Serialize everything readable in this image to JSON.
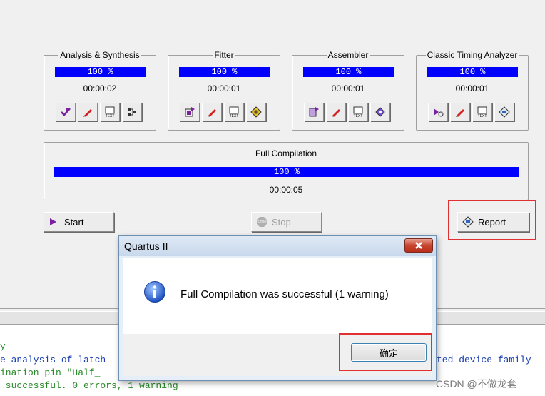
{
  "stages": [
    {
      "title": "Analysis & Synthesis",
      "progress": "100 %",
      "time": "00:00:02",
      "tools": [
        "start-analysis-icon",
        "edit-settings-icon",
        "report-text-icon",
        "netlist-viewer-icon"
      ]
    },
    {
      "title": "Fitter",
      "progress": "100 %",
      "time": "00:00:01",
      "tools": [
        "start-fitter-icon",
        "edit-settings-icon",
        "report-text-icon",
        "floorplan-icon"
      ]
    },
    {
      "title": "Assembler",
      "progress": "100 %",
      "time": "00:00:01",
      "tools": [
        "start-assembler-icon",
        "edit-settings-icon",
        "report-text-icon",
        "programmer-icon"
      ]
    },
    {
      "title": "Classic Timing Analyzer",
      "progress": "100 %",
      "time": "00:00:01",
      "tools": [
        "start-timing-icon",
        "edit-settings-icon",
        "report-text-icon",
        "timing-report-icon"
      ]
    }
  ],
  "full": {
    "title": "Full Compilation",
    "progress": "100 %",
    "time": "00:00:05"
  },
  "buttons": {
    "start": "Start",
    "stop": "Stop",
    "report": "Report"
  },
  "console": {
    "lines": [
      "y",
      "e analysis of latch",
      "ination pin \"Half_",
      " successful. 0 errors, 1 warning"
    ],
    "right_text": "ted device family"
  },
  "dialog": {
    "title": "Quartus II",
    "message": "Full Compilation was successful (1 warning)",
    "ok": "确定"
  },
  "watermark": "CSDN @不做龙套",
  "colors": {
    "progress": "#0000ff",
    "highlight": "#e03030"
  }
}
